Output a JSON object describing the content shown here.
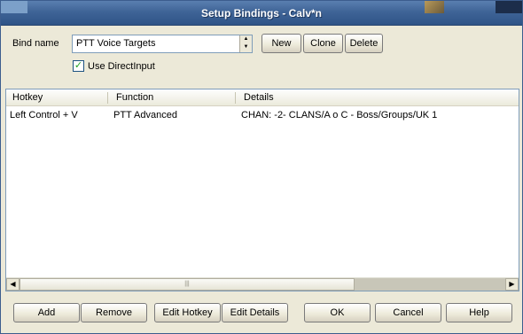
{
  "window": {
    "title": "Setup Bindings - Calv*n"
  },
  "bind": {
    "label": "Bind name",
    "selected": "PTT Voice Targets",
    "new_label": "New",
    "clone_label": "Clone",
    "delete_label": "Delete"
  },
  "directinput": {
    "label": "Use DirectInput",
    "checked": true
  },
  "list": {
    "columns": [
      "Hotkey",
      "Function",
      "Details"
    ],
    "rows": [
      {
        "hotkey": "Left Control + V",
        "function": "PTT Advanced",
        "details": "CHAN: -2- CLANS/A o C - Boss/Groups/UK 1"
      }
    ]
  },
  "buttons": {
    "add": "Add",
    "remove": "Remove",
    "edit_hotkey": "Edit Hotkey",
    "edit_details": "Edit Details",
    "ok": "OK",
    "cancel": "Cancel",
    "help": "Help"
  },
  "icons": {
    "spinner": "up-down-spinner-icon",
    "checkbox": "checkmark-icon",
    "scroll_left": "scroll-left-arrow-icon",
    "scroll_right": "scroll-right-arrow-icon"
  }
}
